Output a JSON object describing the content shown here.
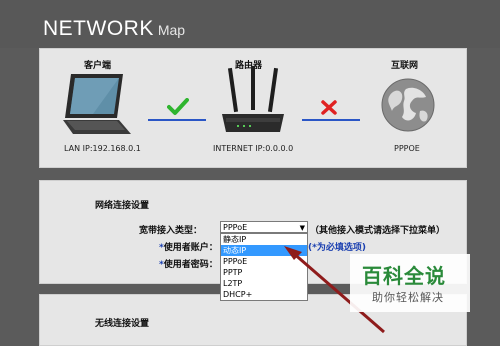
{
  "header": {
    "title": "NETWORK",
    "subtitle": "Map"
  },
  "map": {
    "client": {
      "label": "客户端",
      "info": "LAN IP:192.168.0.1"
    },
    "router": {
      "label": "路由器",
      "info": "INTERNET IP:0.0.0.0"
    },
    "internet": {
      "label": "互联网",
      "info": "PPPOE"
    },
    "status_colors": {
      "ok": "#2fb52f",
      "fail": "#e02222",
      "link": "#2a56c6"
    }
  },
  "settings": {
    "section_title": "网络连接设置",
    "connection_type_label": "宽带接入类型：",
    "selected_type": "PPPoE",
    "other_modes_note": "（其他接入模式请选择下拉菜单）",
    "account_label": "使用者账户：",
    "password_label": "使用者密码：",
    "required_note": "(*为必填选项)",
    "required_mark": "*",
    "options": [
      "静态IP",
      "动态IP",
      "PPPoE",
      "PPTP",
      "L2TP",
      "DHCP+"
    ],
    "highlighted_option_index": 1
  },
  "wireless": {
    "section_title": "无线连接设置"
  },
  "watermark": {
    "main": "百科全说",
    "sub": "助你轻松解决"
  }
}
